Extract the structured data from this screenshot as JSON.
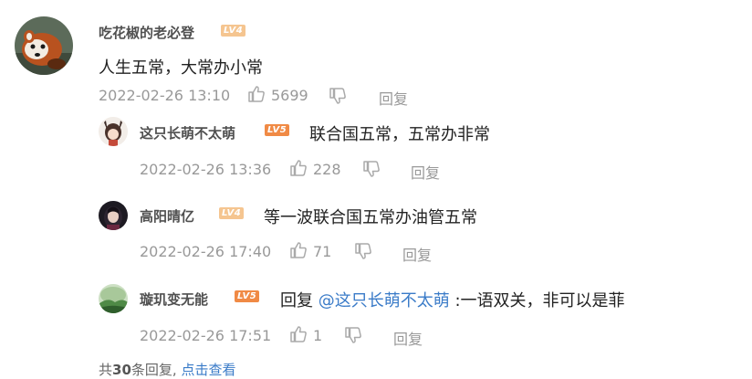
{
  "colors": {
    "level_low": "#f5c590",
    "level_high": "#f08a45",
    "link": "#3a7bc8",
    "meta_text": "#999999"
  },
  "main_comment": {
    "username": "吃花椒的老必登",
    "level": "LV4",
    "content": "人生五常，大常办小常",
    "timestamp": "2022-02-26 13:10",
    "likes": "5699",
    "reply_label": "回复"
  },
  "replies": [
    {
      "username": "这只长萌不太萌",
      "level": "LV5",
      "content": "联合国五常，五常办非常",
      "timestamp": "2022-02-26 13:36",
      "likes": "228",
      "reply_label": "回复"
    },
    {
      "username": "高阳晴亿",
      "level": "LV4",
      "content": "等一波联合国五常办油管五常",
      "timestamp": "2022-02-26 17:40",
      "likes": "71",
      "reply_label": "回复"
    },
    {
      "username": "璇玑变无能",
      "level": "LV5",
      "content_prefix": "回复",
      "mention": "@这只长萌不太萌",
      "content_suffix": ":一语双关，非可以是菲",
      "timestamp": "2022-02-26 17:51",
      "likes": "1",
      "reply_label": "回复"
    }
  ],
  "footer": {
    "prefix": "共",
    "count": "30",
    "suffix": "条回复,",
    "view_link": "点击查看"
  }
}
